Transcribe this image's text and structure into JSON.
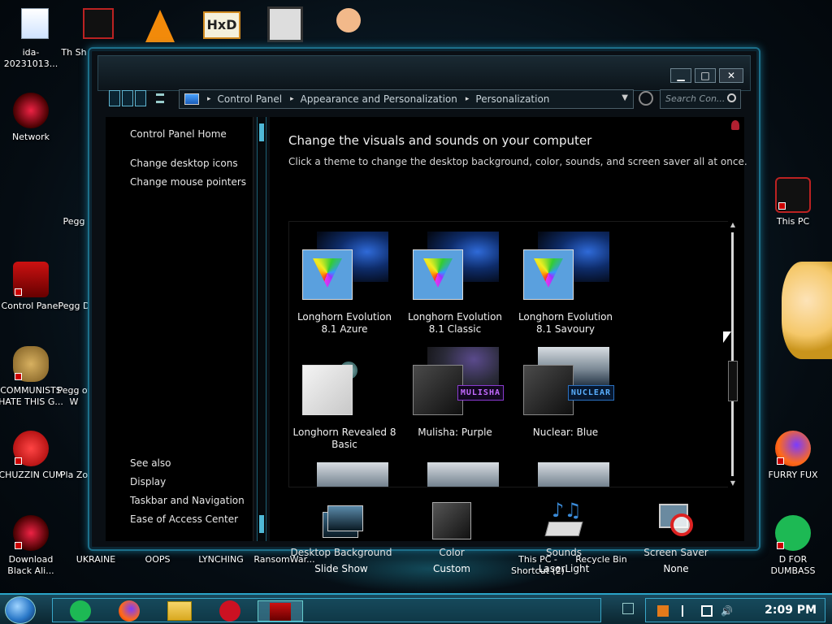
{
  "desktop": {
    "icons_left": [
      {
        "label": "ida-20231013..."
      },
      {
        "label": "Network"
      },
      {
        "label": "Control Panel"
      },
      {
        "label": "COMMUNISTS HATE THIS G..."
      },
      {
        "label": "CHUZZIN CUM"
      },
      {
        "label": "Download Black Ali..."
      }
    ],
    "icons_col2": [
      {
        "label": "Th Sh"
      },
      {
        "label": "Pegg"
      },
      {
        "label": "Pegg D"
      },
      {
        "label": "Pegg of W"
      },
      {
        "label": "Pla Zo"
      },
      {
        "label": "UKRAINE"
      }
    ],
    "icons_bottom": [
      {
        "label": "OOPS"
      },
      {
        "label": "LYNCHING"
      },
      {
        "label": "RansomWar..."
      },
      {
        "label": "This PC - Shortcut (2)"
      },
      {
        "label": "Recycle Bin"
      }
    ],
    "icons_right": [
      {
        "label": "This PC"
      },
      {
        "label": "FURRY FUX"
      },
      {
        "label": "D FOR DUMBASS"
      }
    ]
  },
  "window": {
    "controls": {
      "minimize": "▁",
      "maximize": "□",
      "close": "✕"
    },
    "address": {
      "crumbs": [
        "Control Panel",
        "Appearance and Personalization",
        "Personalization"
      ],
      "separator": "▸"
    },
    "search": {
      "placeholder": "Search Con..."
    },
    "left_pane": {
      "home": "Control Panel Home",
      "links": [
        "Change desktop icons",
        "Change mouse pointers"
      ],
      "see_also_header": "See also",
      "see_also": [
        "Display",
        "Taskbar and Navigation",
        "Ease of Access Center"
      ]
    },
    "main": {
      "title": "Change the visuals and sounds on your computer",
      "subtitle": "Click a theme to change the desktop background, color, sounds, and screen saver all at once.",
      "themes": [
        {
          "name": "Longhorn Evolution 8.1 Azure"
        },
        {
          "name": "Longhorn Evolution 8.1 Classic"
        },
        {
          "name": "Longhorn Evolution 8.1 Savoury"
        },
        {
          "name": "Longhorn Revealed 8 Basic"
        },
        {
          "name": "Mulisha: Purple",
          "tag": "MULISHA"
        },
        {
          "name": "Nuclear: Blue",
          "tag": "NUCLEAR"
        }
      ],
      "quick_settings": [
        {
          "label": "Desktop Background",
          "value": "Slide Show"
        },
        {
          "label": "Color",
          "value": "Custom"
        },
        {
          "label": "Sounds",
          "value": "LaserLight"
        },
        {
          "label": "Screen Saver",
          "value": "None"
        }
      ]
    }
  },
  "taskbar": {
    "clock": "2:09 PM"
  },
  "colors": {
    "accent": "#2aa4c8",
    "window_bg": "#0a0f14",
    "content_bg": "#000000"
  }
}
